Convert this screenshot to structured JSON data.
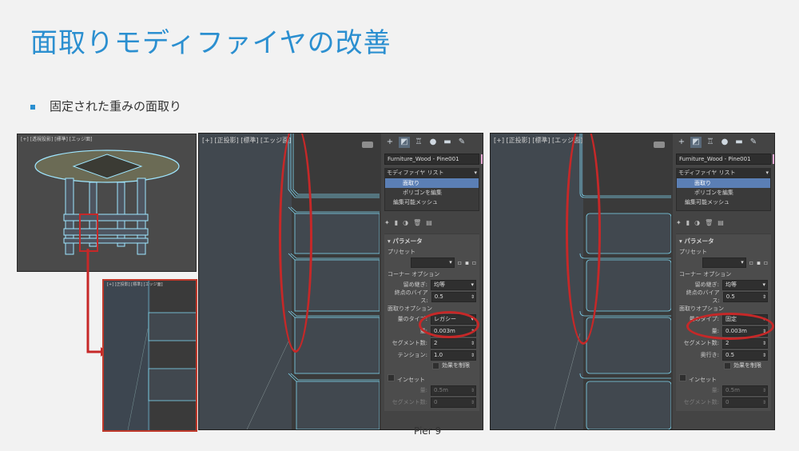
{
  "title": "面取りモディファイヤの改善",
  "bullet": "固定された重みの面取り",
  "footer": "Pier 9",
  "mini": {
    "header": "[+] [透視投影] [標準] [エッジ面]"
  },
  "zoom": {
    "header": "[+] [正投影] [標準] [エッジ面]"
  },
  "panels": [
    {
      "viewport_header": "[+] [正投影] [標準] [エッジ面]",
      "object_name": "Furniture_Wood - Pine001",
      "modifier_list": "モディファイヤ リスト",
      "stack": [
        "面取り",
        "ポリゴンを編集",
        "編集可能メッシュ"
      ],
      "params_header": "パラメータ",
      "preset_label": "プリセット",
      "corner_header": "コーナー オプション",
      "seam_label": "留め継ぎ:",
      "seam_value": "均等",
      "endbias_label": "終点のバイアス:",
      "endbias_value": "0.5",
      "chamfer_header": "面取りオプション",
      "type_label": "量のタイプ:",
      "type_value": "レガシー",
      "amount_label": "量:",
      "amount_value": "0.003m",
      "segments_label": "セグメント数:",
      "segments_value": "2",
      "third_label": "テンション:",
      "third_value": "1.0",
      "check_label": "効果を制限",
      "inset_label": "インセット",
      "inset_amount_label": "量:",
      "inset_amount_value": "0.5m",
      "inset_seg_label": "セグメント数:",
      "inset_seg_value": "0"
    },
    {
      "viewport_header": "[+] [正投影] [標準] [エッジ面]",
      "object_name": "Furniture_Wood - Pine001",
      "modifier_list": "モディファイヤ リスト",
      "stack": [
        "面取り",
        "ポリゴンを編集",
        "編集可能メッシュ"
      ],
      "params_header": "パラメータ",
      "preset_label": "プリセット",
      "corner_header": "コーナー オプション",
      "seam_label": "留め継ぎ:",
      "seam_value": "均等",
      "endbias_label": "終点のバイアス:",
      "endbias_value": "0.5",
      "chamfer_header": "面取りオプション",
      "type_label": "量のタイプ:",
      "type_value": "固定",
      "amount_label": "量:",
      "amount_value": "0.003m",
      "segments_label": "セグメント数:",
      "segments_value": "2",
      "third_label": "奥行き:",
      "third_value": "0.5",
      "check_label": "効果を制限",
      "inset_label": "インセット",
      "inset_amount_label": "量:",
      "inset_amount_value": "0.5m",
      "inset_seg_label": "セグメント数:",
      "inset_seg_value": "0"
    }
  ],
  "colors": {
    "accent": "#2b8fd0",
    "annotation": "#c62828",
    "selection": "#5b7fb5",
    "wire": "#7fd6ef"
  }
}
